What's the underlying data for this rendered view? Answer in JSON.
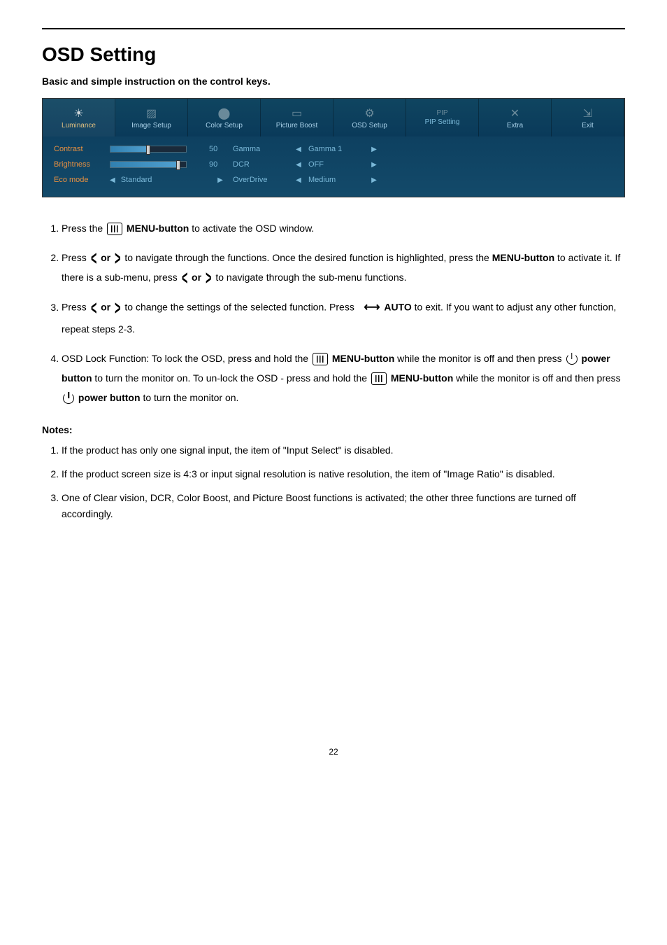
{
  "page_title": "OSD Setting",
  "subtitle": "Basic and simple instruction on the control keys.",
  "osd": {
    "tabs": [
      {
        "label": "Luminance",
        "icon": "☀"
      },
      {
        "label": "Image Setup",
        "icon": "▨"
      },
      {
        "label": "Color Setup",
        "icon": "⬤"
      },
      {
        "label": "Picture Boost",
        "icon": "▭"
      },
      {
        "label": "OSD Setup",
        "icon": "⚙"
      },
      {
        "label": "PIP Setting",
        "icon": "PIP"
      },
      {
        "label": "Extra",
        "icon": "✕"
      },
      {
        "label": "Exit",
        "icon": "⇲"
      }
    ],
    "rows": {
      "contrast": {
        "label": "Contrast",
        "value": "50",
        "opt_label": "Gamma",
        "opt_value": "Gamma 1"
      },
      "brightness": {
        "label": "Brightness",
        "value": "90",
        "opt_label": "DCR",
        "opt_value": "OFF"
      },
      "eco": {
        "label": "Eco mode",
        "value": "Standard",
        "opt_label": "OverDrive",
        "opt_value": "Medium"
      }
    }
  },
  "instructions": {
    "step1_a": "Press the ",
    "step1_b": " MENU-button",
    "step1_c": " to activate the OSD window.",
    "step2_a": "Press ",
    "step2_b": " or ",
    "step2_c": " to navigate through the functions. Once the desired function is highlighted, press the ",
    "step2_d": "MENU-button",
    "step2_e": " to activate it. If there is a sub-menu, press ",
    "step2_f": " or ",
    "step2_g": " to navigate through the sub-menu functions.",
    "step3_a": "Press ",
    "step3_b": " or ",
    "step3_c": " to change the settings of the selected function. Press ",
    "step3_d": " AUTO",
    "step3_e": " to exit. If you want to adjust any other function, repeat steps 2-3.",
    "step4_a": "OSD Lock Function: To lock the OSD, press and hold the ",
    "step4_b": " MENU-button",
    "step4_c": " while the monitor is off and then press ",
    "step4_d": " power button",
    "step4_e": " to turn the monitor on. To un-lock the OSD - press and hold the ",
    "step4_f": " MENU-button",
    "step4_g": " while the monitor is off and then press ",
    "step4_h": " power button",
    "step4_i": " to turn the monitor on."
  },
  "notes_heading": "Notes:",
  "notes": {
    "n1": "If the product has only one signal input, the item of \"Input Select\" is disabled.",
    "n2": "If the product screen size is 4:3 or input signal resolution is native resolution, the item of \"Image Ratio\" is disabled.",
    "n3": "One of Clear vision, DCR, Color Boost, and Picture Boost functions is activated; the other three functions are turned off accordingly."
  },
  "page_number": "22"
}
